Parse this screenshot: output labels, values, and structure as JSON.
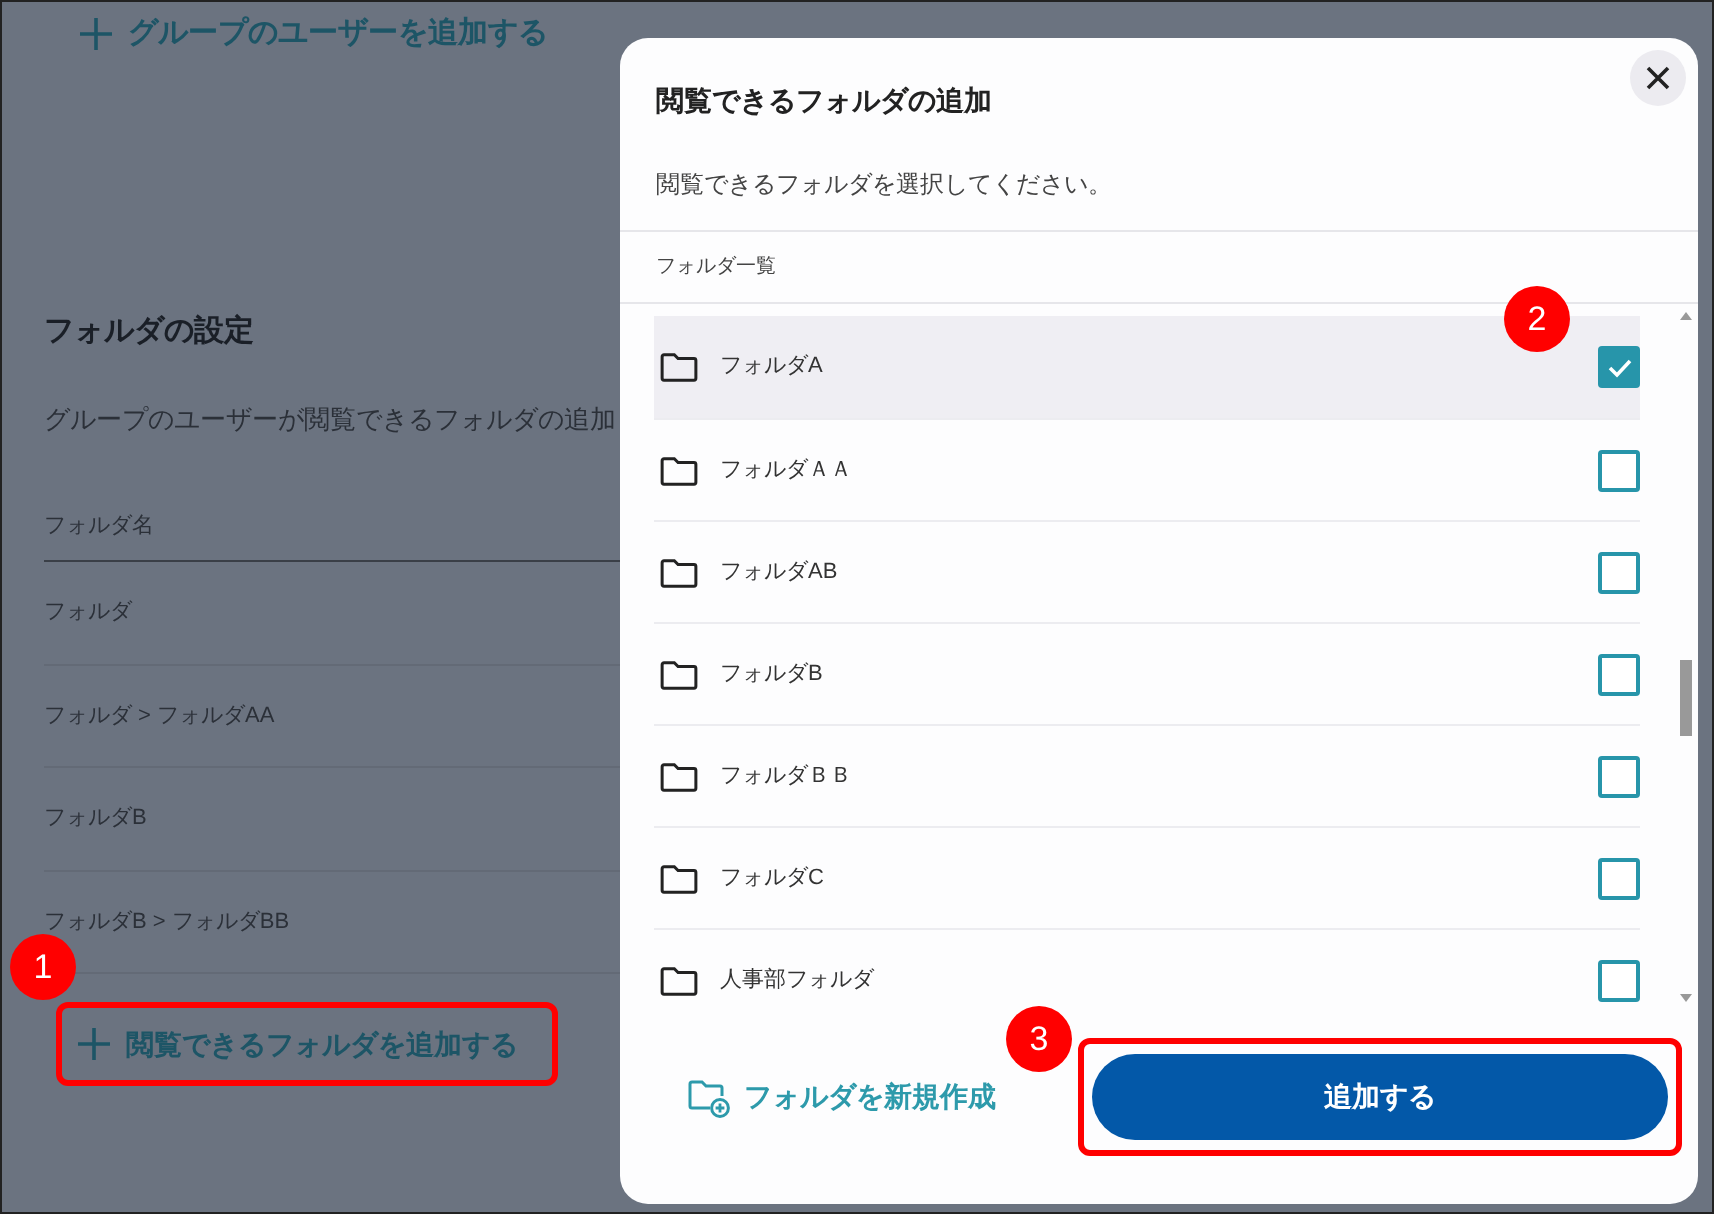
{
  "page": {
    "add_user_link": "グループのユーザーを追加する",
    "section_title": "フォルダの設定",
    "section_description": "グループのユーザーが閲覧できるフォルダの追加",
    "table": {
      "columns": [
        "フォルダ名"
      ],
      "rows": [
        "フォルダ",
        "フォルダ > フォルダAA",
        "フォルダB",
        "フォルダB > フォルダBB"
      ]
    },
    "add_folder_link": "閲覧できるフォルダを追加する"
  },
  "dialog": {
    "title": "閲覧できるフォルダの追加",
    "description": "閲覧できるフォルダを選択してください。",
    "list_header": "フォルダ一覧",
    "folders": [
      {
        "name": "フォルダA",
        "checked": true
      },
      {
        "name": "フォルダＡＡ",
        "checked": false
      },
      {
        "name": "フォルダAB",
        "checked": false
      },
      {
        "name": "フォルダB",
        "checked": false
      },
      {
        "name": "フォルダＢＢ",
        "checked": false
      },
      {
        "name": "フォルダC",
        "checked": false
      },
      {
        "name": "人事部フォルダ",
        "checked": false
      }
    ],
    "new_folder_button": "フォルダを新規作成",
    "submit_button": "追加する"
  },
  "callouts": [
    "1",
    "2",
    "3"
  ]
}
